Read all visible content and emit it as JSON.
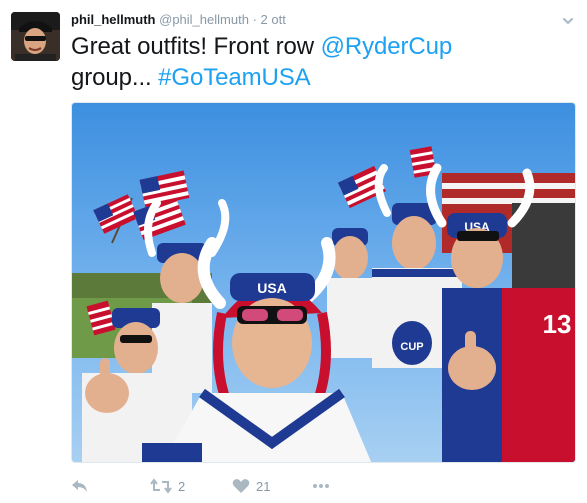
{
  "tweet": {
    "display_name": "phil_hellmuth",
    "handle": "@phil_hellmuth",
    "separator": "·",
    "timestamp": "2 ott",
    "text_parts": {
      "part1": "Great outfits!  Front row ",
      "mention": "@RyderCup",
      "part2": "group... ",
      "hashtag": "#GoTeamUSA"
    }
  },
  "media": {
    "shirt_letters": "USA",
    "badge_text": "CUP",
    "jersey_number": "13"
  },
  "actions": {
    "retweet_count": "2",
    "like_count": "21"
  },
  "colors": {
    "link": "#1da1f2",
    "muted": "#8899a6",
    "usa_red": "#c8102e",
    "usa_blue": "#1f3a93"
  },
  "icons": {
    "reply": "reply-icon",
    "retweet": "retweet-icon",
    "like": "heart-icon",
    "more": "more-icon",
    "menu": "chevron-down-icon"
  }
}
